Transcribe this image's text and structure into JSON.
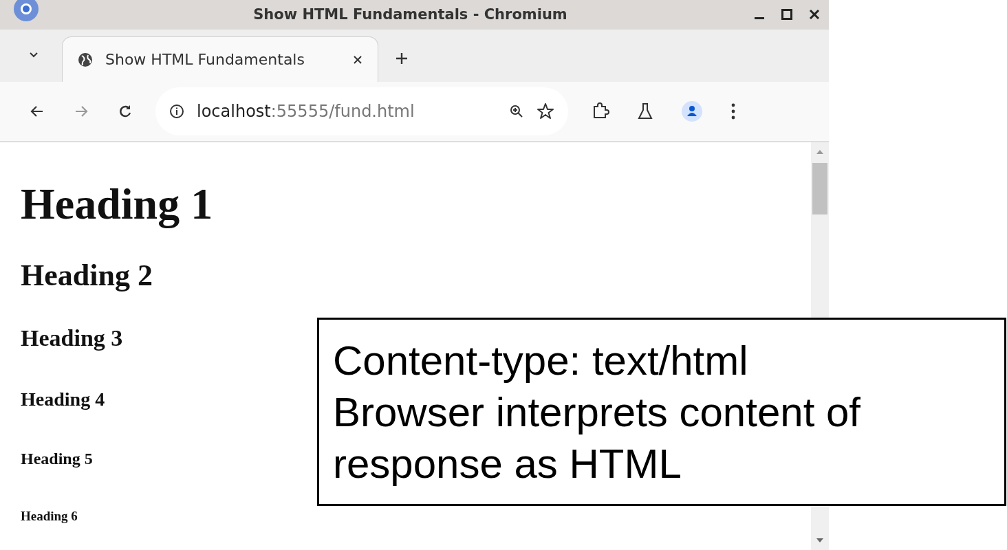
{
  "window": {
    "title": "Show HTML Fundamentals - Chromium"
  },
  "tabs": [
    {
      "label": "Show HTML Fundamentals",
      "selected": true
    }
  ],
  "address": {
    "host": "localhost",
    "path": ":55555/fund.html"
  },
  "page": {
    "headings": [
      {
        "kind": "h1",
        "text": "Heading 1"
      },
      {
        "kind": "h2",
        "text": "Heading 2"
      },
      {
        "kind": "h3",
        "text": "Heading 3"
      },
      {
        "kind": "h4",
        "text": "Heading 4"
      },
      {
        "kind": "h5",
        "text": "Heading 5"
      },
      {
        "kind": "h6",
        "text": "Heading 6"
      }
    ]
  },
  "callout": {
    "lines": [
      "Content-type: text/html",
      "Browser interprets content of response as HTML"
    ]
  }
}
